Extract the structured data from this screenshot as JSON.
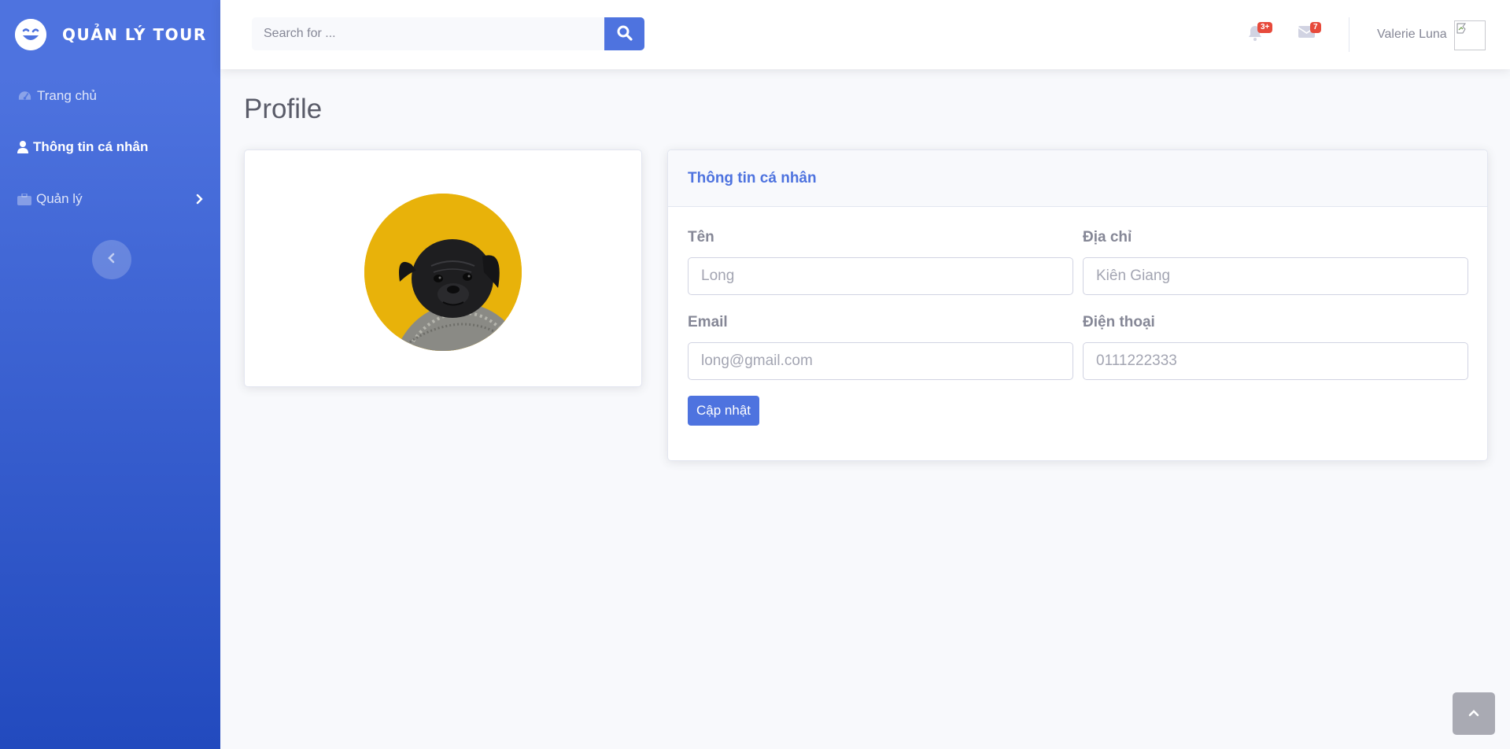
{
  "brand": {
    "title": "QUẢN LÝ TOUR",
    "icon": "laugh-wink-icon"
  },
  "sidebar": {
    "items": [
      {
        "label": "Trang chủ",
        "icon": "tachometer-icon",
        "active": false
      },
      {
        "label": "Thông tin cá nhân",
        "icon": "user-icon",
        "active": true
      },
      {
        "label": "Quản lý",
        "icon": "briefcase-icon",
        "active": false,
        "has_submenu": true
      }
    ]
  },
  "topbar": {
    "search_placeholder": "Search for ...",
    "alerts_badge": "3+",
    "messages_badge": "7",
    "user_name": "Valerie Luna"
  },
  "page": {
    "title": "Profile"
  },
  "profile_card": {
    "header": "Thông tin cá nhân",
    "fields": {
      "name_label": "Tên",
      "name_placeholder": "Long",
      "address_label": "Địa chỉ",
      "address_placeholder": "Kiên Giang",
      "email_label": "Email",
      "email_placeholder": "long@gmail.com",
      "phone_label": "Điện thoại",
      "phone_placeholder": "0111222333"
    },
    "submit_label": "Cập nhật"
  },
  "colors": {
    "primary": "#4e73df",
    "sidebar_gradient_end": "#224abe",
    "danger": "#e74a3b",
    "background": "#f8f9fc",
    "avatar_bg": "#e8b20a"
  }
}
